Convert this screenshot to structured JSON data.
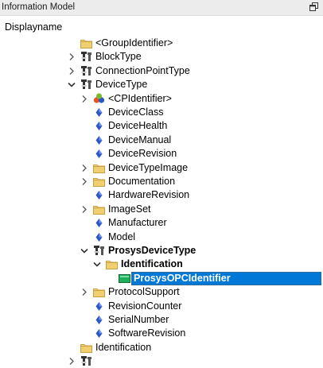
{
  "window": {
    "title": "Information Model"
  },
  "tree_header": "Displayname",
  "tree": [
    {
      "label": "<GroupIdentifier>",
      "indent": 0,
      "chevron": "none",
      "icon": "folder-icon",
      "bold": false,
      "selected": false
    },
    {
      "label": "BlockType",
      "indent": 0,
      "chevron": "right",
      "icon": "type-icon",
      "bold": false,
      "selected": false
    },
    {
      "label": "ConnectionPointType",
      "indent": 0,
      "chevron": "right",
      "icon": "type-icon",
      "bold": false,
      "selected": false
    },
    {
      "label": "DeviceType",
      "indent": 0,
      "chevron": "down",
      "icon": "type-icon",
      "bold": false,
      "selected": false
    },
    {
      "label": "<CPIdentifier>",
      "indent": 1,
      "chevron": "right",
      "icon": "objects-icon",
      "bold": false,
      "selected": false
    },
    {
      "label": "DeviceClass",
      "indent": 1,
      "chevron": "none",
      "icon": "property-icon",
      "bold": false,
      "selected": false
    },
    {
      "label": "DeviceHealth",
      "indent": 1,
      "chevron": "none",
      "icon": "property-icon",
      "bold": false,
      "selected": false
    },
    {
      "label": "DeviceManual",
      "indent": 1,
      "chevron": "none",
      "icon": "property-icon",
      "bold": false,
      "selected": false
    },
    {
      "label": "DeviceRevision",
      "indent": 1,
      "chevron": "none",
      "icon": "property-icon",
      "bold": false,
      "selected": false
    },
    {
      "label": "DeviceTypeImage",
      "indent": 1,
      "chevron": "right",
      "icon": "folder-icon",
      "bold": false,
      "selected": false
    },
    {
      "label": "Documentation",
      "indent": 1,
      "chevron": "right",
      "icon": "folder-icon",
      "bold": false,
      "selected": false
    },
    {
      "label": "HardwareRevision",
      "indent": 1,
      "chevron": "none",
      "icon": "property-icon",
      "bold": false,
      "selected": false
    },
    {
      "label": "ImageSet",
      "indent": 1,
      "chevron": "right",
      "icon": "folder-icon",
      "bold": false,
      "selected": false
    },
    {
      "label": "Manufacturer",
      "indent": 1,
      "chevron": "none",
      "icon": "property-icon",
      "bold": false,
      "selected": false
    },
    {
      "label": "Model",
      "indent": 1,
      "chevron": "none",
      "icon": "property-icon",
      "bold": false,
      "selected": false
    },
    {
      "label": "ProsysDeviceType",
      "indent": 1,
      "chevron": "down",
      "icon": "type-icon",
      "bold": true,
      "selected": false
    },
    {
      "label": "Identification",
      "indent": 2,
      "chevron": "down",
      "icon": "folder-icon",
      "bold": true,
      "selected": false
    },
    {
      "label": "ProsysOPCIdentifier",
      "indent": 3,
      "chevron": "none",
      "icon": "green-object-icon",
      "bold": true,
      "selected": true
    },
    {
      "label": "ProtocolSupport",
      "indent": 1,
      "chevron": "right",
      "icon": "folder-icon",
      "bold": false,
      "selected": false
    },
    {
      "label": "RevisionCounter",
      "indent": 1,
      "chevron": "none",
      "icon": "property-icon",
      "bold": false,
      "selected": false
    },
    {
      "label": "SerialNumber",
      "indent": 1,
      "chevron": "none",
      "icon": "property-icon",
      "bold": false,
      "selected": false
    },
    {
      "label": "SoftwareRevision",
      "indent": 1,
      "chevron": "none",
      "icon": "property-icon",
      "bold": false,
      "selected": false
    },
    {
      "label": "Identification",
      "indent": 0,
      "chevron": "none",
      "icon": "folder-icon",
      "bold": false,
      "selected": false
    },
    {
      "label": "",
      "indent": 0,
      "chevron": "right",
      "icon": "type-icon",
      "bold": false,
      "selected": false
    }
  ],
  "colors": {
    "selection": "#0078d7",
    "folder": "#e8c56d",
    "property": "#2a56c6"
  }
}
